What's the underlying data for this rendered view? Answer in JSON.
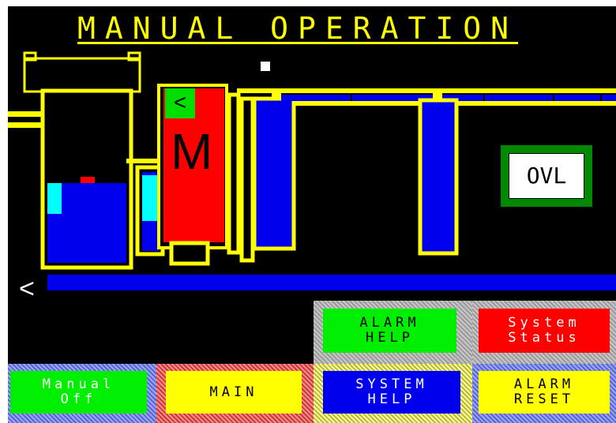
{
  "screen": {
    "title": "MANUAL OPERATION",
    "motor_label": "M",
    "motor_direction": "<",
    "overload_label": "OVL",
    "conveyor_direction": "<"
  },
  "buttons": {
    "alarm_help": {
      "line1": "ALARM",
      "line2": "HELP"
    },
    "system_status": {
      "line1": "System",
      "line2": "Status"
    },
    "manual_off": {
      "line1": "Manual",
      "line2": "Off"
    },
    "main": {
      "line1": "MAIN"
    },
    "system_help": {
      "line1": "SYSTEM",
      "line2": "HELP"
    },
    "alarm_reset": {
      "line1": "ALARM",
      "line2": "RESET"
    }
  },
  "colors": {
    "background": "#000000",
    "pipe": "#ffff00",
    "liquid": "#0000ee",
    "motor": "#ff0000",
    "run_indicator": "#00dd00",
    "sensor": "#00ffff",
    "overload_frame": "#008800"
  }
}
